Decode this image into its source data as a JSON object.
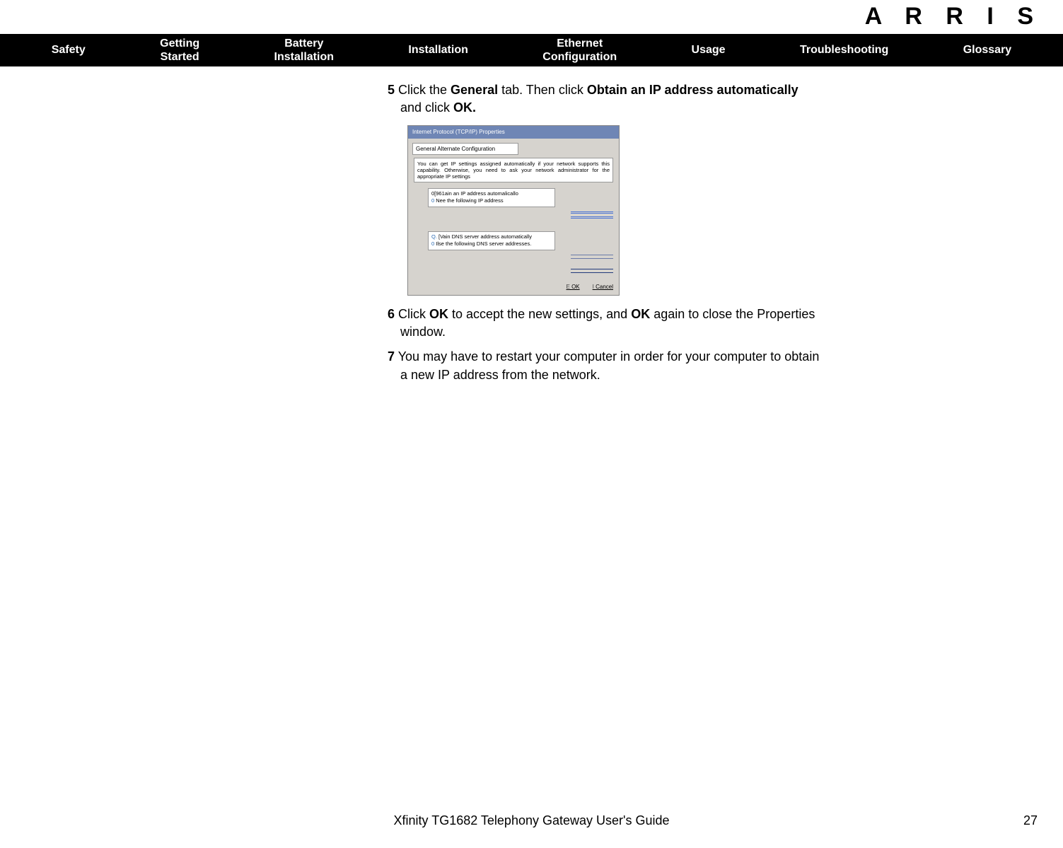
{
  "brand": "A R R I S",
  "nav": {
    "safety": "Safety",
    "getting_started_l1": "Getting",
    "getting_started_l2": "Started",
    "battery_l1": "Battery",
    "battery_l2": "Installation",
    "installation": "Installation",
    "ethernet_l1": "Ethernet",
    "ethernet_l2": "Configuration",
    "usage": "Usage",
    "troubleshooting": "Troubleshooting",
    "glossary": "Glossary"
  },
  "steps": {
    "s5_num": "5",
    "s5_a": " Click the ",
    "s5_b": "General",
    "s5_c": " tab. Then click ",
    "s5_d": "Obtain an IP address automatically",
    "s5_e": "and click ",
    "s5_f": "OK.",
    "s6_num": "6",
    "s6_a": " Click ",
    "s6_b": "OK",
    "s6_c": " to accept the new settings, and ",
    "s6_d": "OK",
    "s6_e": " again to close the Properties",
    "s6_f": "window.",
    "s7_num": "7",
    "s7_a": " You may have to restart your computer in order for your computer to obtain",
    "s7_b": "a new IP address from the network."
  },
  "dialog": {
    "title": "Internet Protocol (TCP/IP) Properties",
    "tabs": "General Alternate Configuration",
    "info": "You can get IP settings assigned automatically if your network supports this capability. Otherwise, you need to ask your network administrator for the appropriate IP settings",
    "r1a": "0[961ain an IP address automalicallo",
    "r1b_m": "0",
    "r1b": " Nee the following IP address",
    "r2a_pre": "Q.",
    "r2a": " [Vain DNS server address automatically",
    "r2b_m": "0",
    "r2b": " Ilse the following DNS server addresses.",
    "btn_ok_pre": "E ",
    "btn_ok": "OK",
    "btn_cancel_pre": "I       ",
    "btn_cancel": "Cancel"
  },
  "footer": {
    "guide": "Xfinity TG1682 Telephony Gateway User's Guide",
    "page": "27"
  }
}
